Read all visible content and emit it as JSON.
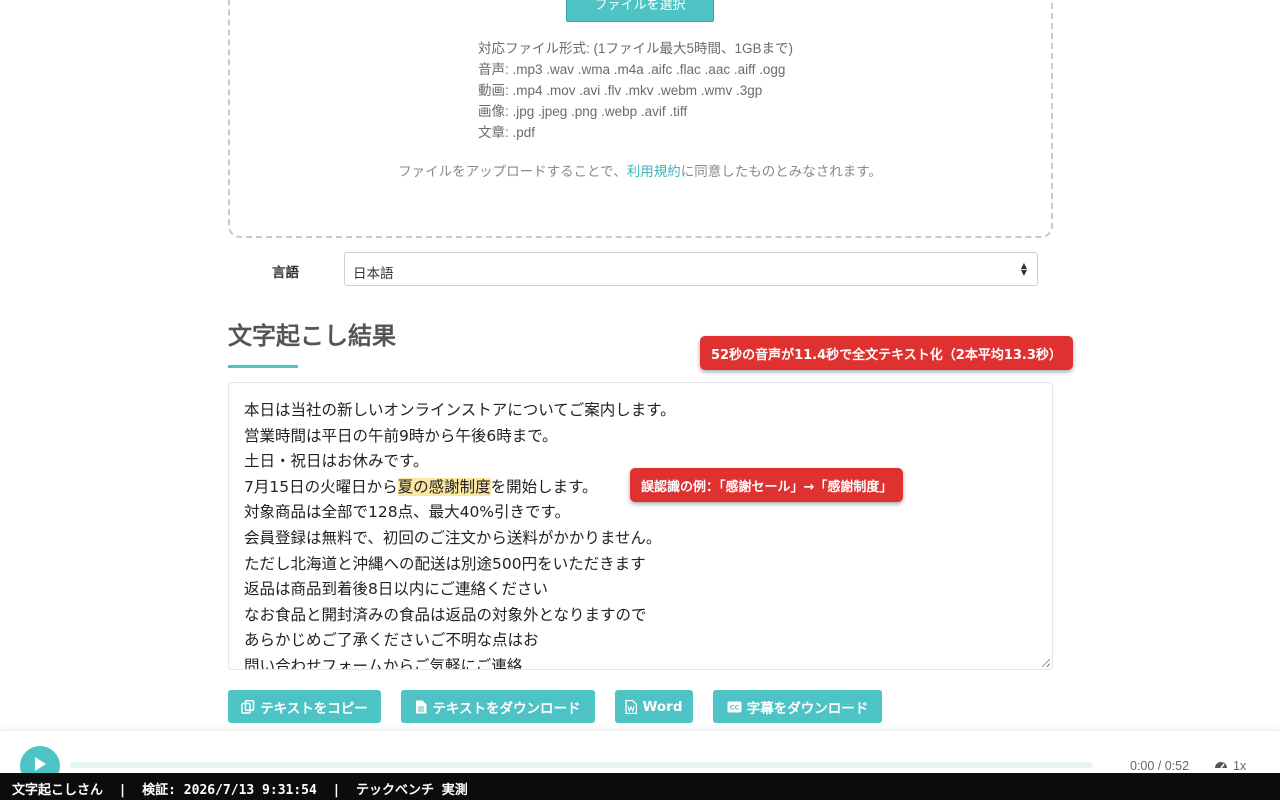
{
  "upload": {
    "select_button": "ファイルを選択",
    "formats": [
      "対応ファイル形式: (1ファイル最大5時間、1GBまで)",
      "音声: .mp3 .wav .wma .m4a .aifc .flac .aac .aiff .ogg",
      "動画: .mp4 .mov .avi .flv .mkv .webm .wmv .3gp",
      "画像: .jpg .jpeg .png .webp .avif .tiff",
      "文章: .pdf"
    ],
    "terms_before": "ファイルをアップロードすることで、",
    "terms_link": "利用規約",
    "terms_after": "に同意したものとみなされます。"
  },
  "language": {
    "label": "言語",
    "selected": "日本語"
  },
  "result": {
    "title": "文字起こし結果",
    "badge_speed": "52秒の音声が11.4秒で全文テキスト化（2本平均13.3秒）",
    "badge_error": "誤認識の例：「感謝セール」→「感謝制度」",
    "lines": [
      "本日は当社の新しいオンラインストアについてご案内します。",
      "営業時間は平日の午前9時から午後6時まで。",
      "土日・祝日はお休みです。",
      "7月15日の火曜日から",
      "夏の感謝制度",
      "を開始します。",
      "対象商品は全部で128点、最大40%引きです。",
      "会員登録は無料で、初回のご注文から送料がかかりません。",
      "ただし北海道と沖縄への配送は別途500円をいただきます",
      "返品は商品到着後8日以内にご連絡ください",
      "なお食品と開封済みの食品は返品の対象外となりますので",
      "あらかじめご了承くださいご不明な点はお",
      "問い合わせフォームからご気軽にご連絡"
    ]
  },
  "actions": {
    "copy": "テキストをコピー",
    "download": "テキストをダウンロード",
    "word": "Word",
    "subtitles": "字幕をダウンロード"
  },
  "player": {
    "time": "0:00 / 0:52",
    "speed": "1x"
  },
  "footer": {
    "text": "文字起こしさん  |  検証: 2026/7/13 9:31:54  |  テックベンチ 実測"
  },
  "colors": {
    "accent": "#4ec3c6",
    "badge": "#e03131",
    "highlight": "#fbe7a1"
  }
}
